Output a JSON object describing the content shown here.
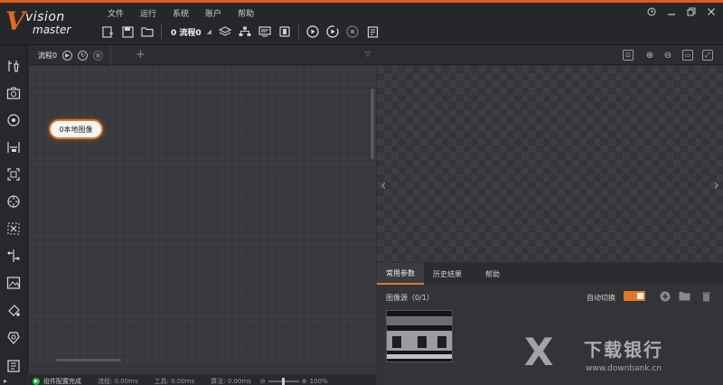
{
  "logo": {
    "mark": "V",
    "word1": "vision",
    "word2": "master"
  },
  "menu": [
    "文件",
    "运行",
    "系统",
    "账户",
    "帮助"
  ],
  "toolbar": {
    "flow_select": "0 流程0",
    "icons": [
      "new-solution-icon",
      "save-icon",
      "open-folder-icon",
      "layers-icon",
      "hierarchy-icon",
      "global-variable-icon",
      "communication-icon",
      "run-once-icon",
      "run-loop-icon",
      "stop-icon",
      "report-icon"
    ]
  },
  "window_controls": [
    "clock-icon",
    "minimize-icon",
    "restore-icon",
    "close-icon"
  ],
  "sidebar": {
    "tools": [
      "image-tools-icon",
      "camera-icon",
      "locate-icon",
      "measure-icon",
      "recognize-icon",
      "calibrate-icon",
      "align-icon",
      "logic-icon",
      "image-process-icon",
      "color-icon",
      "defect-icon",
      "communicate-icon"
    ],
    "foot": "▸"
  },
  "flow_panel": {
    "tab_label": "流程0",
    "add_tab": "+",
    "node_label": "0本地图像"
  },
  "status": {
    "message": "组件配置完成",
    "flow_time": "流程: 0.00ms",
    "tool_time": "工具: 0.00ms",
    "algo_time": "算法: 0.00ms",
    "zoom": "100%"
  },
  "image_panel": {
    "prev": "‹",
    "next": "›"
  },
  "params": {
    "tabs": [
      "常用参数",
      "历史结果",
      "帮助"
    ],
    "source_label": "图像源（0/1）",
    "auto_switch_label": "自动切换",
    "auto_switch_on": 1
  },
  "watermark": {
    "mark": "X",
    "text": "下载银行",
    "url": "www.downbank.cn"
  },
  "colors": {
    "accent": "#e0772a",
    "status_ok": "#2fae4a"
  }
}
